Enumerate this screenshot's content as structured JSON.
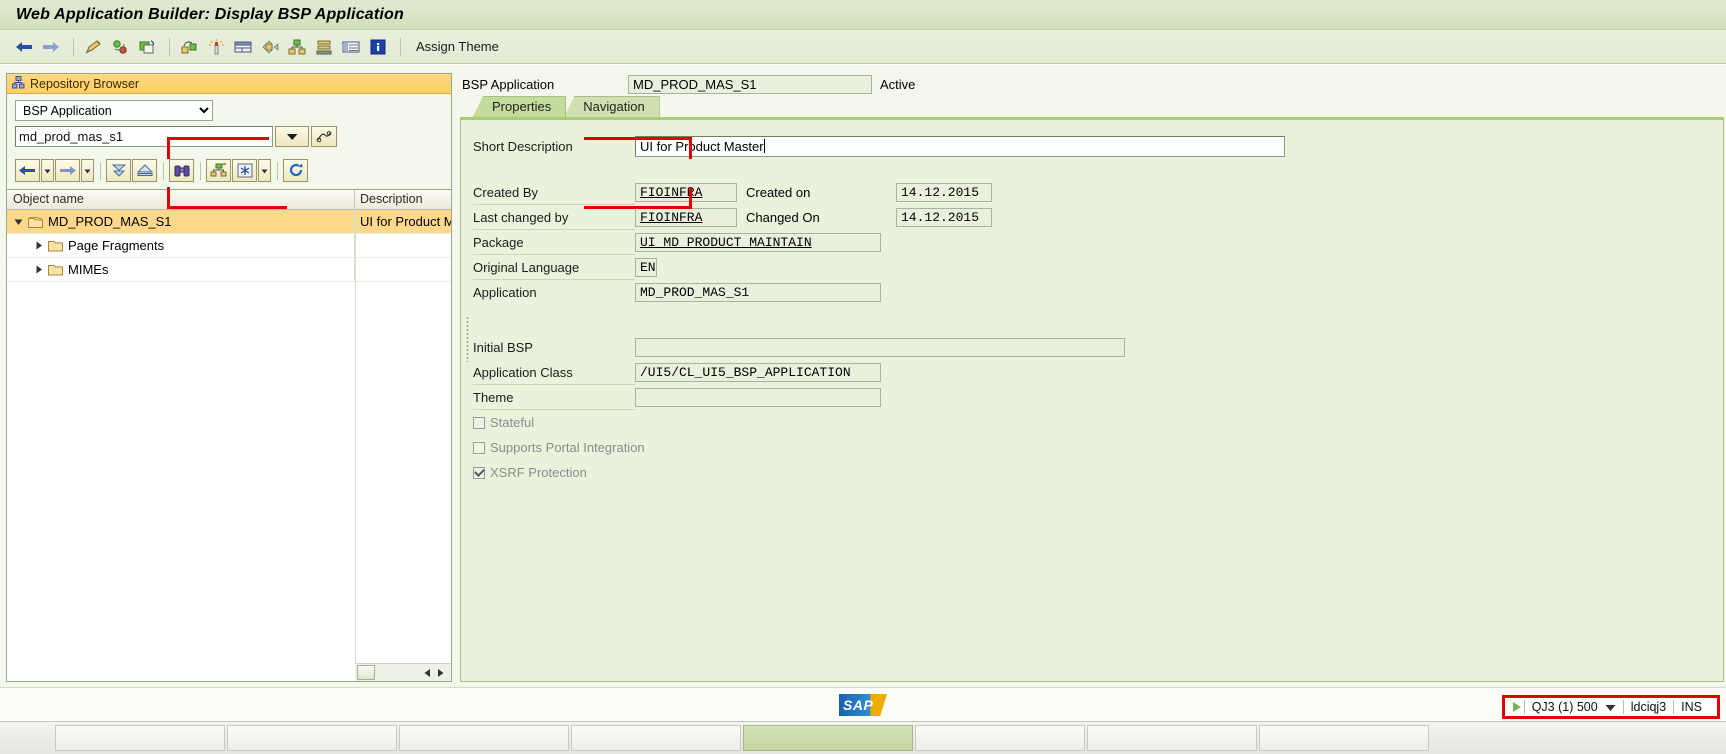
{
  "window": {
    "title": "Web Application Builder: Display BSP Application"
  },
  "toolbar": {
    "icons": [
      {
        "name": "back-arrow-icon"
      },
      {
        "name": "forward-arrow-icon"
      },
      {
        "name": "edit-pencil-icon"
      },
      {
        "name": "refresh-cycle-icon"
      },
      {
        "name": "copy-object-icon"
      },
      {
        "name": "object-link-icon"
      },
      {
        "name": "highlight-wand-icon"
      },
      {
        "name": "layout-editor-icon"
      },
      {
        "name": "navigate-icon"
      },
      {
        "name": "hierarchy-icon"
      },
      {
        "name": "stack-icon"
      },
      {
        "name": "table-view-icon"
      },
      {
        "name": "information-icon"
      }
    ],
    "assign_theme_label": "Assign Theme"
  },
  "repository_browser": {
    "header": "Repository Browser",
    "object_type": {
      "selected": "BSP Application",
      "options": [
        "BSP Application"
      ]
    },
    "object_name_value": "md_prod_mas_s1",
    "object_name_placeholder": "",
    "dropdown_icon": "chevron-down-icon",
    "search_help_icon": "search-help-icon",
    "nav_buttons": [
      {
        "name": "tree-back-button",
        "icon": "back-arrow-icon"
      },
      {
        "name": "tree-back-history-button",
        "icon": "chevron-down-small-icon"
      },
      {
        "name": "tree-forward-button",
        "icon": "forward-arrow-icon"
      },
      {
        "name": "tree-forward-history-button",
        "icon": "chevron-down-small-icon"
      },
      {
        "name": "expand-all-button",
        "icon": "double-chevron-down-icon"
      },
      {
        "name": "collapse-all-button",
        "icon": "chevron-up-icon"
      },
      {
        "name": "find-button",
        "icon": "binoculars-icon"
      },
      {
        "name": "hierarchy-button",
        "icon": "hierarchy-up-icon"
      },
      {
        "name": "other-object-button",
        "icon": "asterisk-icon"
      },
      {
        "name": "other-object-dropdown",
        "icon": "chevron-down-small-icon"
      },
      {
        "name": "refresh-button",
        "icon": "refresh-icon"
      }
    ],
    "tree": {
      "columns": [
        "Object name",
        "Description"
      ],
      "rows": [
        {
          "level": 1,
          "expanded": true,
          "icon": "bsp-application-icon",
          "name": "MD_PROD_MAS_S1",
          "description": "UI for Product M",
          "selected": true
        },
        {
          "level": 2,
          "expanded": false,
          "icon": "folder-icon",
          "name": "Page Fragments",
          "description": "",
          "selected": false
        },
        {
          "level": 2,
          "expanded": false,
          "icon": "folder-icon",
          "name": "MIMEs",
          "description": "",
          "selected": false
        }
      ]
    }
  },
  "detail": {
    "bsp_application_label": "BSP Application",
    "bsp_application_value": "MD_PROD_MAS_S1",
    "status": "Active",
    "tabs": [
      {
        "label": "Properties",
        "active": true
      },
      {
        "label": "Navigation",
        "active": false
      }
    ],
    "fields": {
      "short_description_label": "Short Description",
      "short_description_value": "UI for Product Master",
      "created_by_label": "Created By",
      "created_by_value": "FIOINFRA",
      "created_on_label": "Created on",
      "created_on_value": "14.12.2015",
      "last_changed_by_label": "Last changed by",
      "last_changed_by_value": "FIOINFRA",
      "changed_on_label": "Changed On",
      "changed_on_value": "14.12.2015",
      "package_label": "Package",
      "package_value": "UI_MD_PRODUCT_MAINTAIN",
      "original_language_label": "Original Language",
      "original_language_value": "EN",
      "application_label": "Application",
      "application_value": "MD_PROD_MAS_S1",
      "initial_bsp_label": "Initial BSP",
      "initial_bsp_value": "",
      "application_class_label": "Application Class",
      "application_class_value": "/UI5/CL_UI5_BSP_APPLICATION",
      "theme_label": "Theme",
      "theme_value": ""
    },
    "checkboxes": [
      {
        "label": "Stateful",
        "checked": false
      },
      {
        "label": "Supports Portal Integration",
        "checked": false
      },
      {
        "label": "XSRF Protection",
        "checked": true
      }
    ]
  },
  "footer": {
    "logo_text": "SAP"
  },
  "statusbar": {
    "run_icon": "play-icon",
    "system": "QJ3 (1) 500",
    "system_dropdown_icon": "chevron-down-icon",
    "server": "ldciqj3",
    "insert_mode": "INS"
  },
  "colors": {
    "title_bar": "#dbe6c9",
    "accent_green": "#a9cd72",
    "tab_active": "#c3dc9c",
    "tree_selection": "#ffd98b",
    "annotation_red": "#e00000",
    "repository_header": "#ffcf63"
  }
}
